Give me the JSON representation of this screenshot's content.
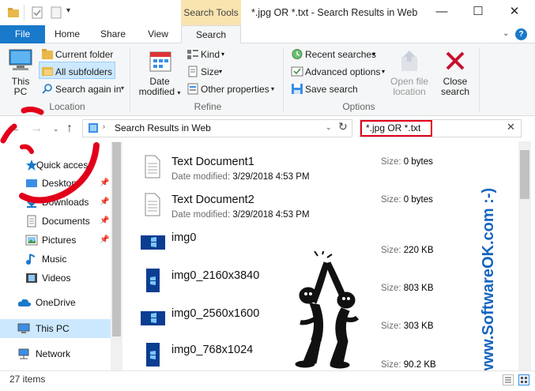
{
  "window": {
    "contextual_tab": "Search Tools",
    "title": "*.jpg OR *.txt - Search Results in Web",
    "minimize": "—",
    "maximize": "☐",
    "close": "✕"
  },
  "tabs": {
    "file": "File",
    "home": "Home",
    "share": "Share",
    "view": "View",
    "search": "Search"
  },
  "ribbon": {
    "location": {
      "this_pc_line1": "This",
      "this_pc_line2": "PC",
      "current_folder": "Current folder",
      "all_subfolders": "All subfolders",
      "search_again_in": "Search again in",
      "label": "Location"
    },
    "refine": {
      "date_modified_line1": "Date",
      "date_modified_line2": "modified",
      "kind": "Kind",
      "size": "Size",
      "other_properties": "Other properties",
      "label": "Refine"
    },
    "options": {
      "recent_searches": "Recent searches",
      "advanced_options": "Advanced options",
      "save_search": "Save search",
      "open_file_location_line1": "Open file",
      "open_file_location_line2": "location",
      "close_search_line1": "Close",
      "close_search_line2": "search",
      "label": "Options"
    }
  },
  "address": {
    "path": "Search Results in Web",
    "search_query": "*.jpg OR *.txt"
  },
  "nav": {
    "quick_access": "Quick access",
    "desktop": "Desktop",
    "downloads": "Downloads",
    "documents": "Documents",
    "pictures": "Pictures",
    "music": "Music",
    "videos": "Videos",
    "onedrive": "OneDrive",
    "this_pc": "This PC",
    "network": "Network"
  },
  "files": [
    {
      "name": "Text Document1",
      "date_key": "Date modified:",
      "date": "3/29/2018 4:53 PM",
      "size_key": "Size:",
      "size": "0 bytes"
    },
    {
      "name": "Text Document2",
      "date_key": "Date modified:",
      "date": "3/29/2018 4:53 PM",
      "size_key": "Size:",
      "size": "0 bytes"
    },
    {
      "name": "img0",
      "size_key": "Size:",
      "size": "220 KB"
    },
    {
      "name": "img0_2160x3840",
      "size_key": "Size:",
      "size": "803 KB"
    },
    {
      "name": "img0_2560x1600",
      "size_key": "Size:",
      "size": "303 KB"
    },
    {
      "name": "img0_768x1024",
      "size_key": "Size:",
      "size": "90.2 KB"
    }
  ],
  "status": {
    "items_count": "27 items"
  },
  "watermark": "www.SoftwareOK.com :-)",
  "colors": {
    "accent": "#1979ca",
    "contextual_tab": "#f9e4b0",
    "selection": "#cce8ff",
    "highlight_red": "#e2001a",
    "watermark_blue": "#1565c0"
  }
}
